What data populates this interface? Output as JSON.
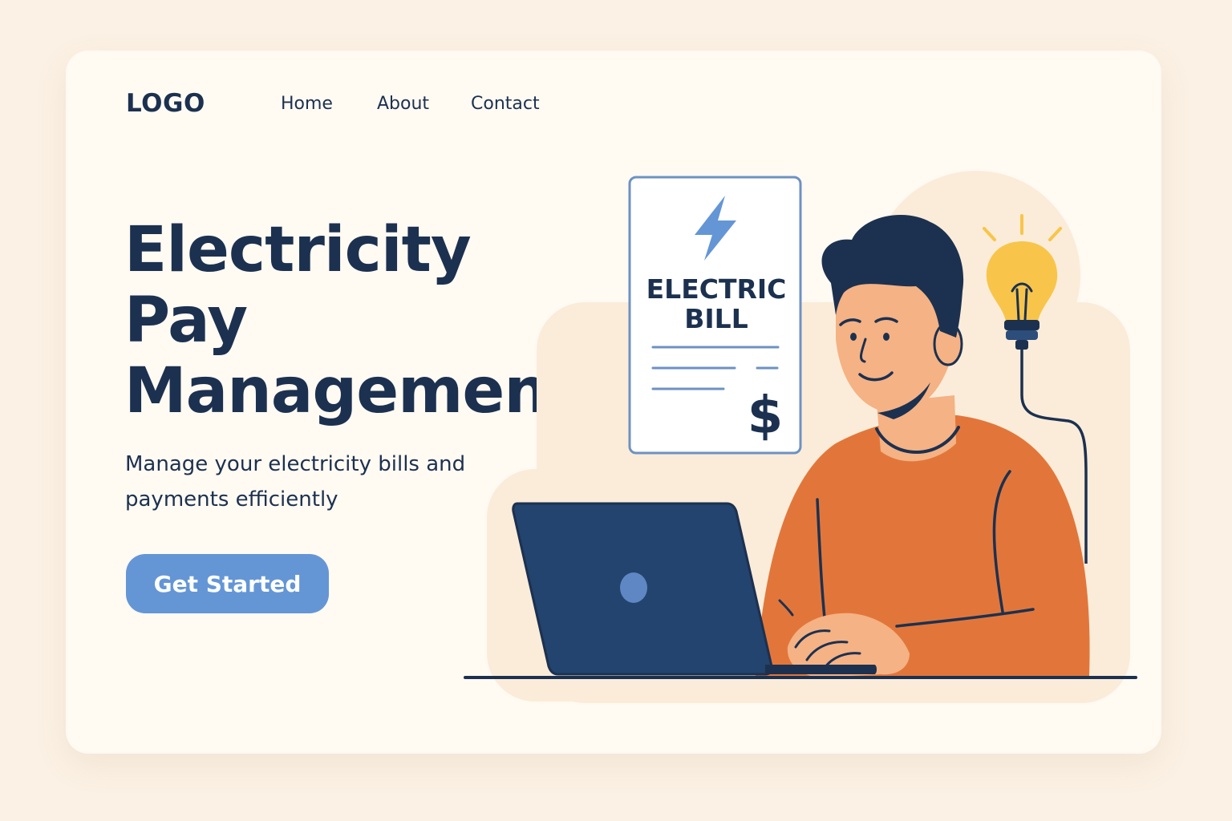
{
  "header": {
    "logo": "LOGO",
    "nav": [
      {
        "label": "Home"
      },
      {
        "label": "About"
      },
      {
        "label": "Contact"
      }
    ]
  },
  "hero": {
    "headline": [
      "Electricity",
      "Pay",
      "Management"
    ],
    "subtitle": "Manage your electricity bills and payments efficiently",
    "cta_label": "Get Started"
  },
  "illustration": {
    "bill_lines": [
      "ELECTRIC",
      "BILL"
    ],
    "currency_symbol": "$",
    "icons": [
      "lightning-icon",
      "dollar-icon",
      "lightbulb-icon",
      "laptop-icon"
    ]
  },
  "colors": {
    "page_background": "#fbf1e4",
    "card_background": "#fffaf2",
    "text_primary": "#1c3150",
    "accent_blue": "#6496d6",
    "sweater_orange": "#e2763a",
    "bulb_yellow": "#f8c54a",
    "laptop_navy": "#22446e"
  }
}
